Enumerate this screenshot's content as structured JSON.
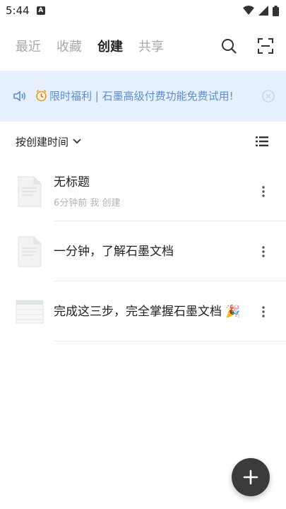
{
  "status_bar": {
    "time": "5:44",
    "notification_letter": "A"
  },
  "nav": {
    "tabs": [
      {
        "label": "最近",
        "active": false
      },
      {
        "label": "收藏",
        "active": false
      },
      {
        "label": "创建",
        "active": true
      },
      {
        "label": "共享",
        "active": false
      }
    ]
  },
  "banner": {
    "text": "限时福利 | 石墨高级付费功能免费试用!"
  },
  "sort": {
    "label": "按创建时间"
  },
  "documents": [
    {
      "title": "无标题",
      "meta": "6分钟前 我 创建",
      "icon": "doc-page-icon"
    },
    {
      "title": "一分钟，了解石墨文档",
      "meta": "",
      "icon": "doc-page-icon"
    },
    {
      "title": "完成这三步，完全掌握石墨文档 🎉",
      "meta": "",
      "icon": "sheet-thumbnail-icon"
    }
  ],
  "colors": {
    "accent": "#5b8ed6",
    "banner_bg": "#e6f0fc",
    "fab": "#3b3b3b",
    "inactive_tab": "#a8a8a8"
  }
}
